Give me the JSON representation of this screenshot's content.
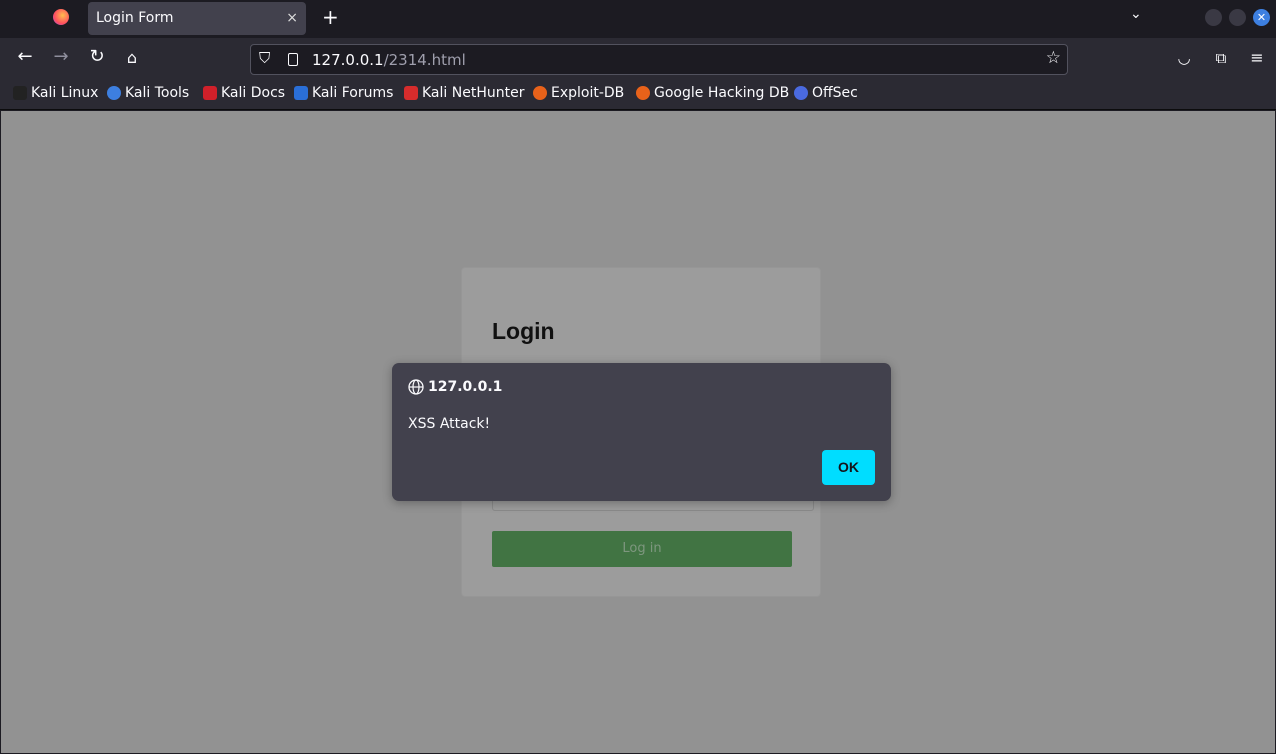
{
  "browser": {
    "tab_title": "Login Form",
    "tab_close": "×",
    "new_tab": "+",
    "url_host": "127.0.0.1",
    "url_path": "/2314.html",
    "bookmarks": [
      {
        "label": "Kali Linux",
        "color": "#222222"
      },
      {
        "label": "Kali Tools",
        "color": "#3d7fe0"
      },
      {
        "label": "Kali Docs",
        "color": "#d0202a"
      },
      {
        "label": "Kali Forums",
        "color": "#2a6fd8"
      },
      {
        "label": "Kali NetHunter",
        "color": "#d62c2c"
      },
      {
        "label": "Exploit-DB",
        "color": "#e8621a"
      },
      {
        "label": "Google Hacking DB",
        "color": "#e8621a"
      },
      {
        "label": "OffSec",
        "color": "#4a6ae0"
      }
    ]
  },
  "page": {
    "title": "Login",
    "login_button": "Log in"
  },
  "dialog": {
    "origin": "127.0.0.1",
    "message": "XSS Attack!",
    "ok": "OK",
    "accent": "#00ddff"
  }
}
